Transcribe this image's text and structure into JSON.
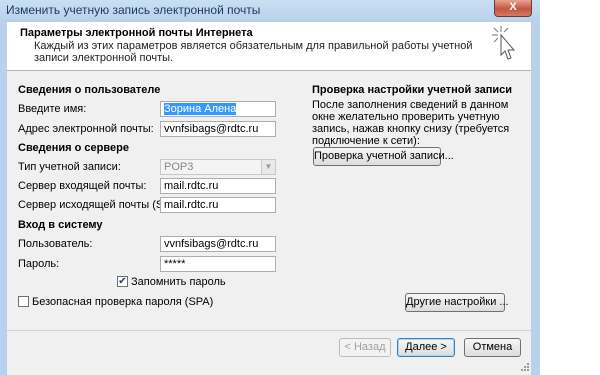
{
  "window": {
    "title": "Изменить учетную запись электронной почты",
    "close_label": "X"
  },
  "header": {
    "title": "Параметры электронной почты Интернета",
    "description": "Каждый из этих параметров является обязательным для правильной работы учетной записи электронной почты."
  },
  "user_info": {
    "section_title": "Сведения о пользователе",
    "name_label": "Введите имя:",
    "name_value": "Зорина Алена",
    "email_label": "Адрес электронной почты:",
    "email_value": "vvnfsibags@rdtc.ru"
  },
  "server_info": {
    "section_title": "Сведения о сервере",
    "account_type_label": "Тип учетной записи:",
    "account_type_value": "POP3",
    "incoming_label": "Сервер входящей почты:",
    "incoming_value": "mail.rdtc.ru",
    "outgoing_label": "Сервер исходящей почты (SMTP):",
    "outgoing_value": "mail.rdtc.ru"
  },
  "login": {
    "section_title": "Вход в систему",
    "user_label": "Пользователь:",
    "user_value": "vvnfsibags@rdtc.ru",
    "password_label": "Пароль:",
    "password_value": "*****",
    "remember_label": "Запомнить пароль",
    "remember_checked": true,
    "spa_label": "Безопасная проверка пароля (SPA)",
    "spa_checked": false
  },
  "test_panel": {
    "title": "Проверка настройки учетной записи",
    "description": "После заполнения сведений в данном окне желательно проверить учетную запись, нажав кнопку снизу (требуется подключение к сети):",
    "test_button": "Проверка учетной записи...",
    "more_settings_button": "Другие настройки ..."
  },
  "footer": {
    "back_button": "< Назад",
    "next_button": "Далее >",
    "cancel_button": "Отмена"
  }
}
